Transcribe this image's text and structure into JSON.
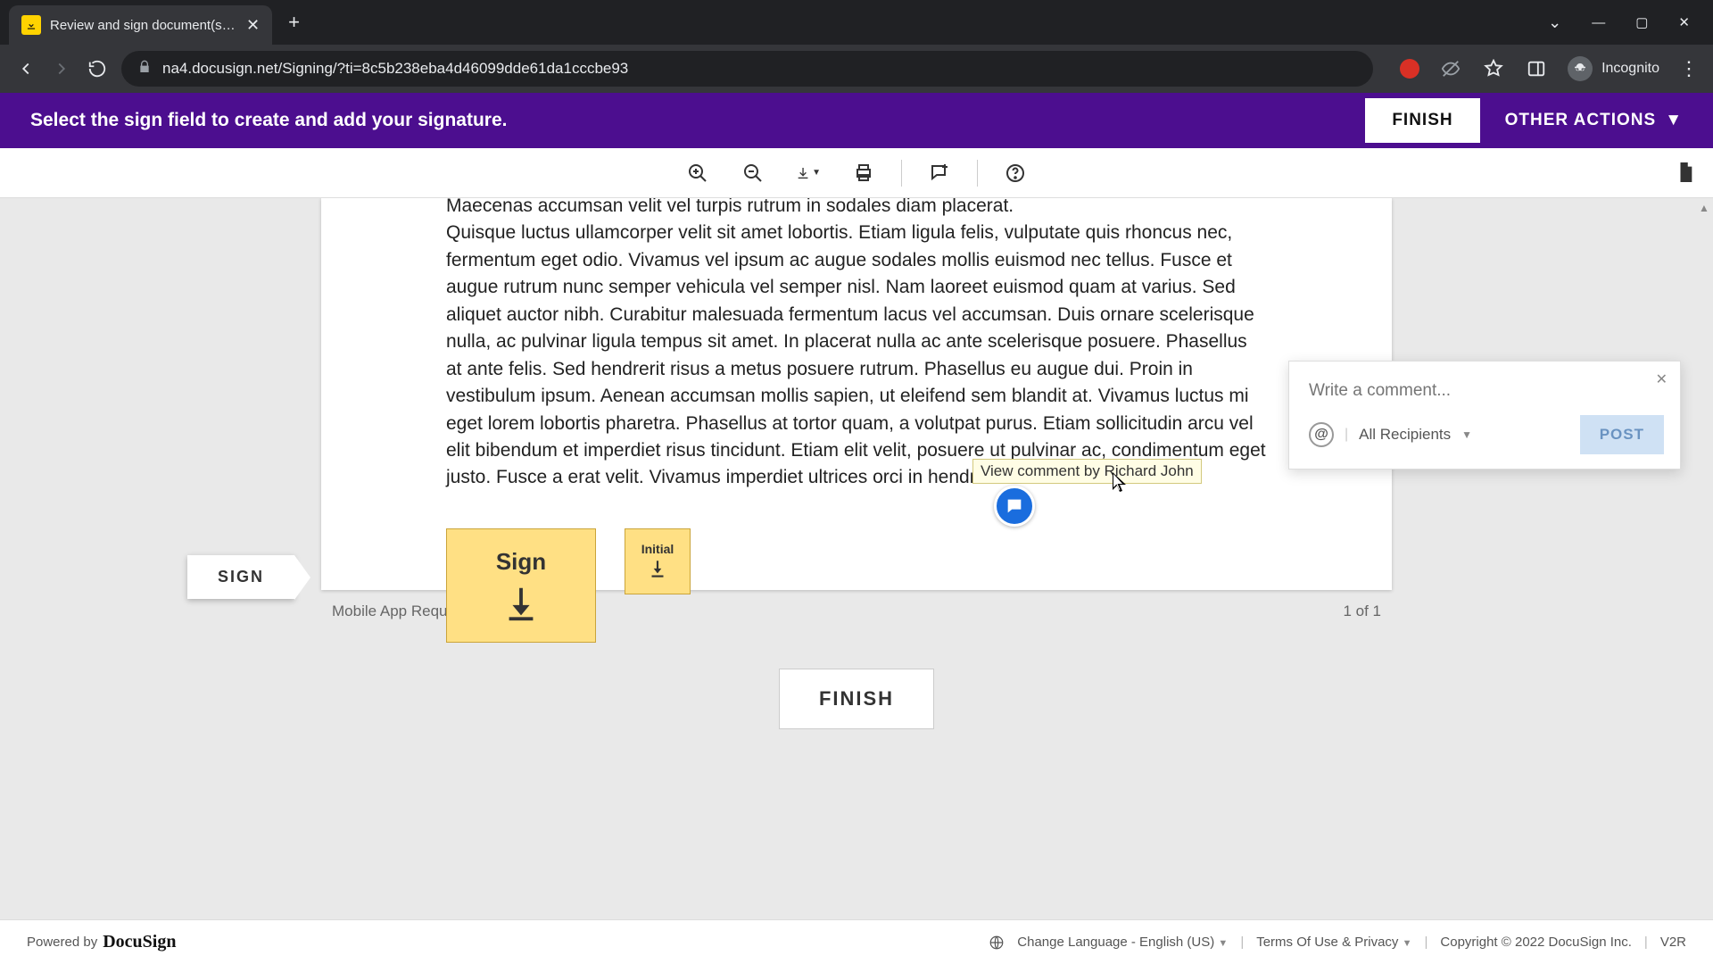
{
  "browser": {
    "tab_title": "Review and sign document(s) | D",
    "url": "na4.docusign.net/Signing/?ti=8c5b238eba4d46099dde61da1cccbe93",
    "incognito_label": "Incognito"
  },
  "banner": {
    "message": "Select the sign field to create and add your signature.",
    "finish": "FINISH",
    "other_actions": "OTHER ACTIONS"
  },
  "document": {
    "paragraph1": "Maecenas accumsan velit vel turpis rutrum in sodales diam placerat.",
    "paragraph2": "Quisque luctus ullamcorper velit sit amet lobortis. Etiam ligula felis, vulputate quis rhoncus nec, fermentum eget odio. Vivamus vel ipsum ac augue sodales mollis euismod nec tellus. Fusce et augue rutrum nunc semper vehicula vel semper nisl. Nam laoreet euismod quam at varius. Sed aliquet auctor nibh. Curabitur malesuada fermentum lacus vel accumsan. Duis ornare scelerisque nulla, ac pulvinar ligula tempus sit amet. In placerat nulla ac ante scelerisque posuere. Phasellus at ante felis. Sed hendrerit risus a metus posuere rutrum. Phasellus eu augue dui. Proin in vestibulum ipsum. Aenean accumsan mollis sapien, ut eleifend sem blandit at. Vivamus luctus mi eget lorem lobortis pharetra. Phasellus at tortor quam, a volutpat purus. Etiam sollicitudin arcu vel elit bibendum et imperdiet risus tincidunt. Etiam elit velit, posuere ut pulvinar ac, condimentum eget justo. Fusce a erat velit. Vivamus imperdiet ultrices orci in hendrerit.",
    "sign_label": "Sign",
    "initial_label": "Initial",
    "sign_tab": "SIGN",
    "comment_tooltip": "View comment by Richard John",
    "filename": "Mobile App Requirements.pdf",
    "page_indicator": "1 of 1",
    "finish": "FINISH"
  },
  "comment_panel": {
    "placeholder": "Write a comment...",
    "recipients": "All Recipients",
    "post": "POST"
  },
  "footer": {
    "powered_by": "Powered by",
    "brand": "DocuSign",
    "language": "Change Language - English (US)",
    "terms": "Terms Of Use & Privacy",
    "copyright": "Copyright © 2022 DocuSign Inc.",
    "version": "V2R"
  }
}
